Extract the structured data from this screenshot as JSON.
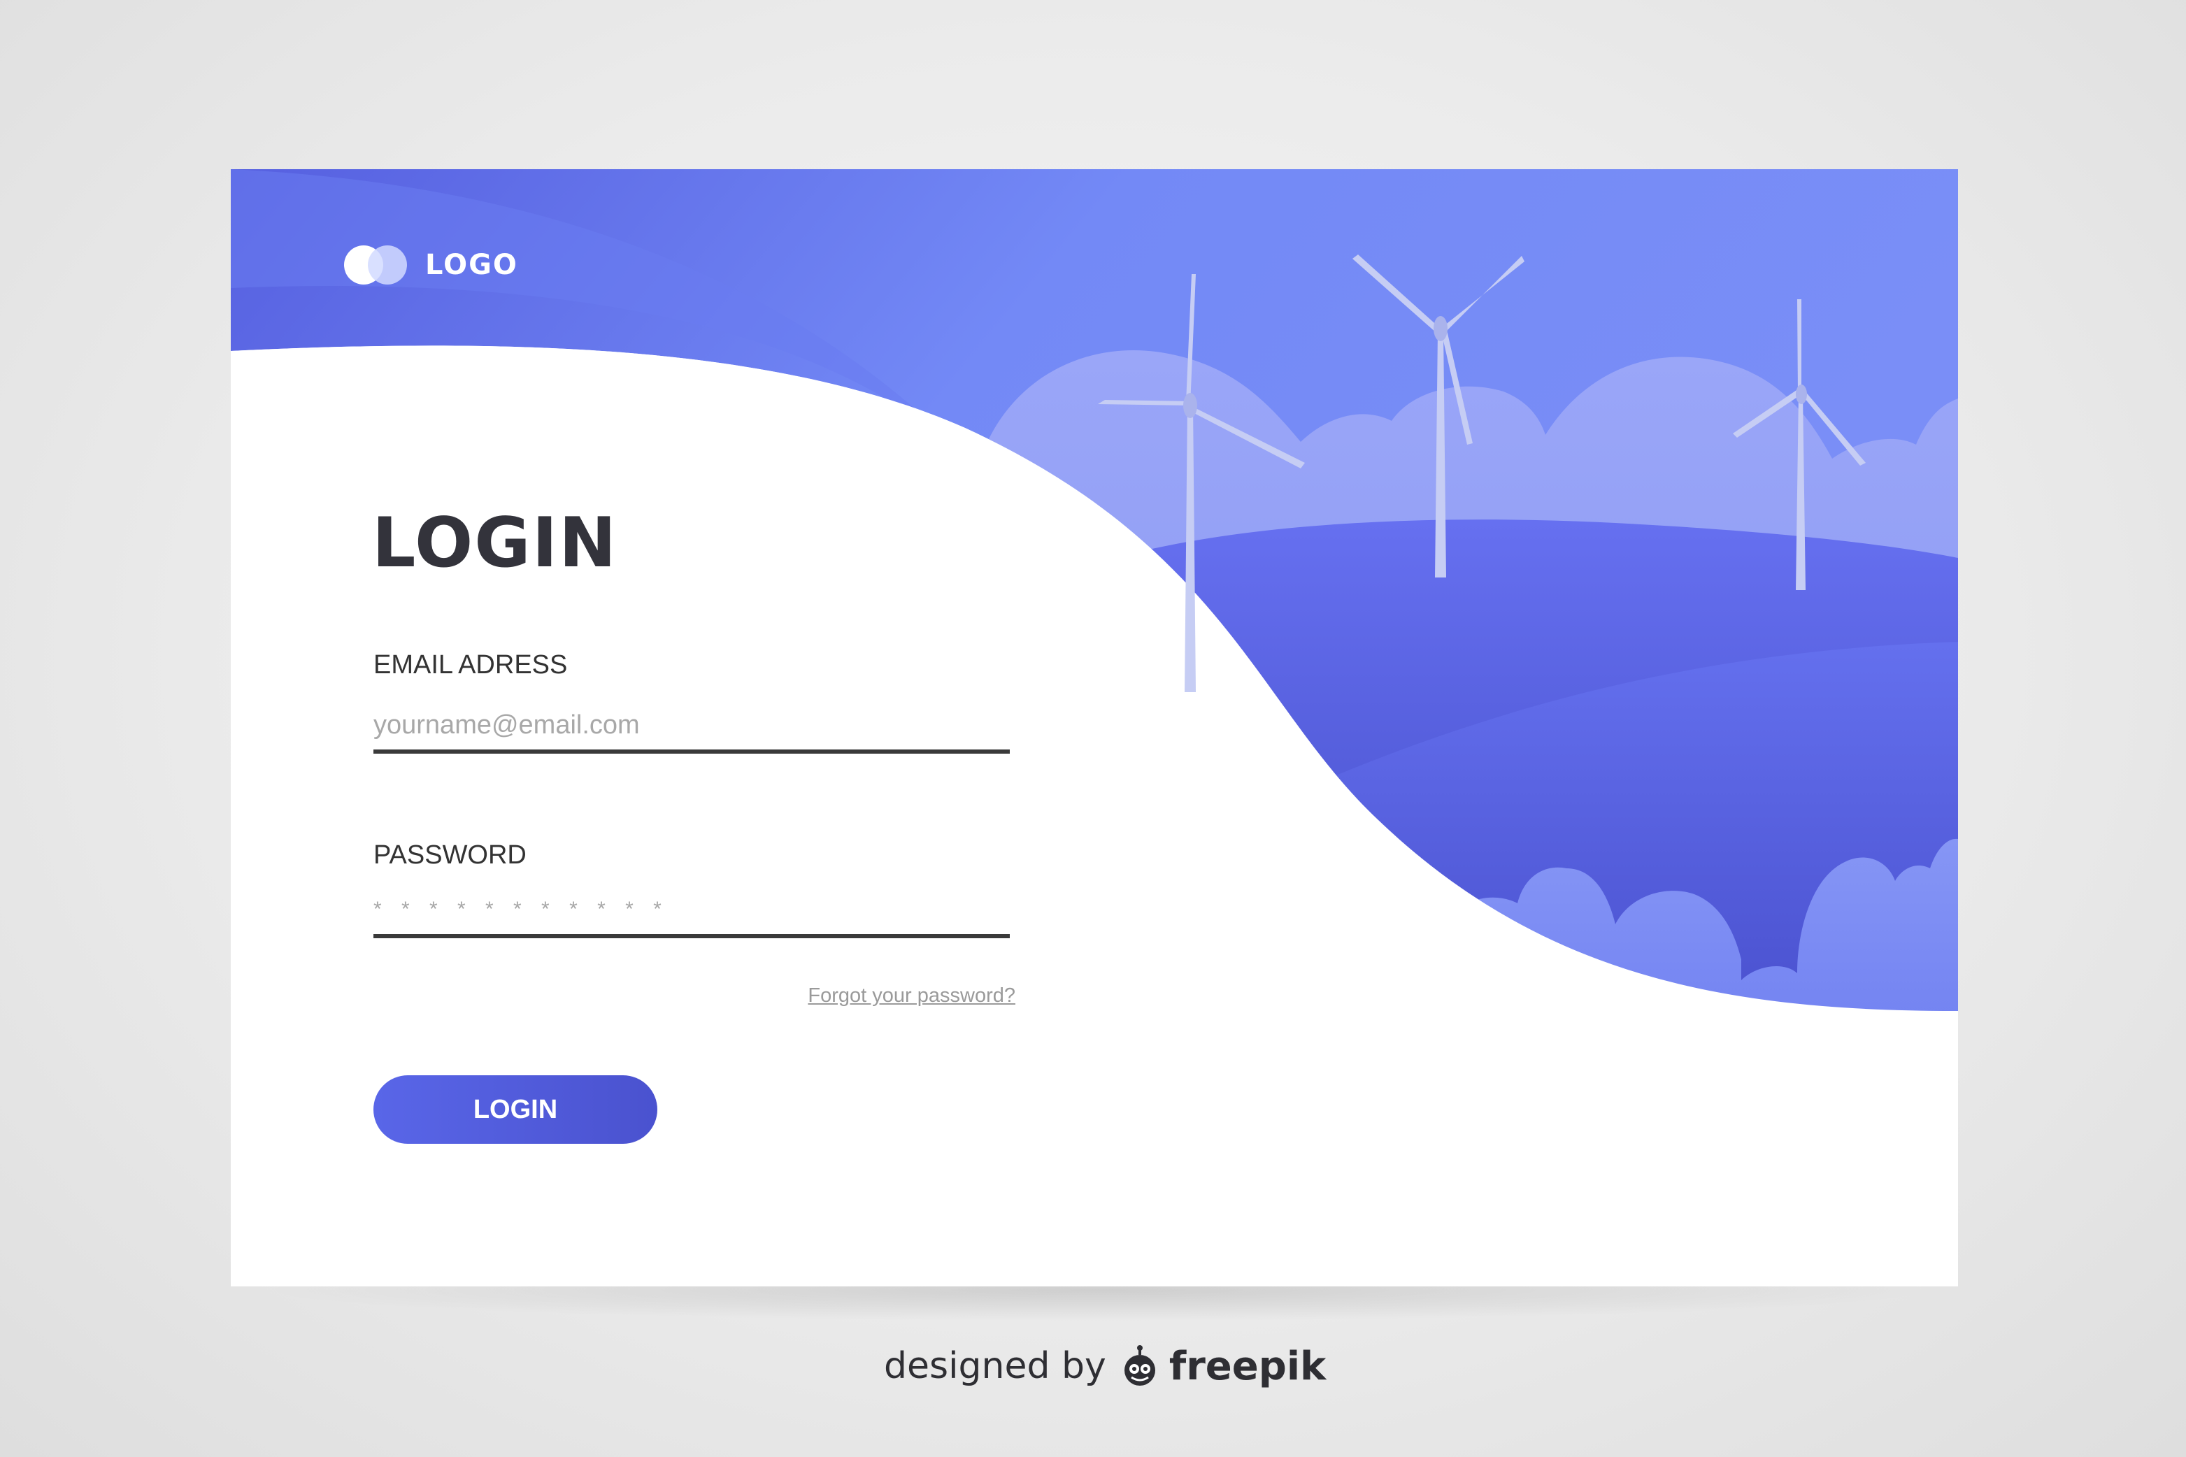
{
  "logo": {
    "text": "LOGO"
  },
  "form": {
    "title": "LOGIN",
    "email": {
      "label": "EMAIL ADRESS",
      "placeholder": "yourname@email.com"
    },
    "password": {
      "label": "PASSWORD",
      "placeholder": "* * * * * * * * * * *"
    },
    "forgot_link": "Forgot your password?",
    "submit_label": "LOGIN"
  },
  "credit": {
    "prefix": "designed by",
    "brand": "freepik"
  },
  "icons": [
    "logo-circles-icon",
    "wind-turbine-icon",
    "freepik-icon"
  ],
  "colors": {
    "primary": "#5966e8",
    "sky": "#7a8ef6",
    "hill_dark": "#4a52cf",
    "turbine": "#c6cdf4",
    "text": "#33333b",
    "background": "#e6e6e6"
  }
}
